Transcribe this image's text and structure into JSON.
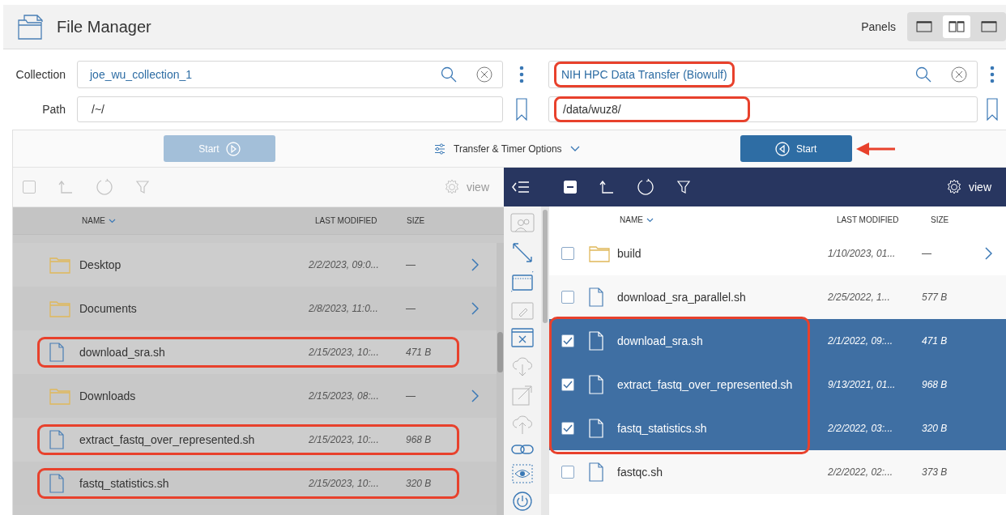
{
  "header": {
    "title": "File Manager",
    "panels_label": "Panels",
    "panel_modes": [
      {
        "kind": "single",
        "selected": false
      },
      {
        "kind": "double",
        "selected": true
      },
      {
        "kind": "single",
        "selected": false
      }
    ]
  },
  "locations": [
    {
      "collection_label": "Collection",
      "collection": "joe_wu_collection_1",
      "path_label": "Path",
      "path": "/~/",
      "outlined": false
    },
    {
      "collection": "NIH HPC Data Transfer (Biowulf)",
      "path": "/data/wuz8/",
      "outlined": true
    }
  ],
  "transfer_bar": {
    "left_start": {
      "label": "Start",
      "disabled": true
    },
    "options_label": "Transfer & Timer Options",
    "right_start": {
      "label": "Start",
      "disabled": false,
      "arrow": true
    }
  },
  "left_pane": {
    "active": false,
    "view_label": "view",
    "select_all": {
      "partial": false
    },
    "columns": [
      {
        "label": "NAME",
        "sorted": true
      },
      {
        "label": "LAST MODIFIED",
        "sorted": false
      },
      {
        "label": "SIZE",
        "sorted": false
      }
    ],
    "rows": [
      {
        "kind": "folder",
        "name": "Desktop",
        "modified": "2/2/2023, 09:0...",
        "size": "—",
        "outlined": false
      },
      {
        "kind": "folder",
        "name": "Documents",
        "modified": "2/8/2023, 11:0...",
        "size": "—",
        "outlined": false
      },
      {
        "kind": "file",
        "name": "download_sra.sh",
        "modified": "2/15/2023, 10:...",
        "size": "471 B",
        "outlined": true
      },
      {
        "kind": "folder",
        "name": "Downloads",
        "modified": "2/15/2023, 08:...",
        "size": "—",
        "outlined": false
      },
      {
        "kind": "file",
        "name": "extract_fastq_over_represented.sh",
        "modified": "2/15/2023, 10:...",
        "size": "968 B",
        "outlined": true
      },
      {
        "kind": "file",
        "name": "fastq_statistics.sh",
        "modified": "2/15/2023, 10:...",
        "size": "320 B",
        "outlined": true
      }
    ]
  },
  "right_pane": {
    "active": true,
    "view_label": "view",
    "select_all": {
      "partial": true
    },
    "side_tools": [
      {
        "kind": "people",
        "disabled": true
      },
      {
        "kind": "arrow",
        "disabled": false
      },
      {
        "kind": "new-folder",
        "disabled": false
      },
      {
        "kind": "rename",
        "disabled": true
      },
      {
        "kind": "delete",
        "disabled": false
      },
      {
        "kind": "download",
        "disabled": true
      },
      {
        "kind": "open",
        "disabled": true
      },
      {
        "kind": "upload",
        "disabled": true
      },
      {
        "kind": "link",
        "disabled": false
      },
      {
        "kind": "eye",
        "disabled": false
      },
      {
        "kind": "power",
        "disabled": false
      }
    ],
    "columns": [
      {
        "label": "NAME",
        "sorted": true
      },
      {
        "label": "LAST MODIFIED",
        "sorted": false
      },
      {
        "label": "SIZE",
        "sorted": false
      }
    ],
    "rows": [
      {
        "kind": "folder",
        "name": "build",
        "modified": "1/10/2023, 01...",
        "size": "—",
        "selected": false,
        "outlined": false
      },
      {
        "kind": "file",
        "name": "download_sra_parallel.sh",
        "modified": "2/25/2022, 1...",
        "size": "577 B",
        "selected": false,
        "outlined": false
      },
      {
        "kind": "file",
        "name": "download_sra.sh",
        "modified": "2/1/2022, 09:...",
        "size": "471 B",
        "selected": true,
        "outlined": true
      },
      {
        "kind": "file",
        "name": "extract_fastq_over_represented.sh",
        "modified": "9/13/2021, 01...",
        "size": "968 B",
        "selected": true,
        "outlined": true
      },
      {
        "kind": "file",
        "name": "fastq_statistics.sh",
        "modified": "2/2/2022, 03:...",
        "size": "320 B",
        "selected": true,
        "outlined": true
      },
      {
        "kind": "file",
        "name": "fastqc.sh",
        "modified": "2/2/2022, 02:...",
        "size": "373 B",
        "selected": false,
        "outlined": false
      }
    ]
  }
}
